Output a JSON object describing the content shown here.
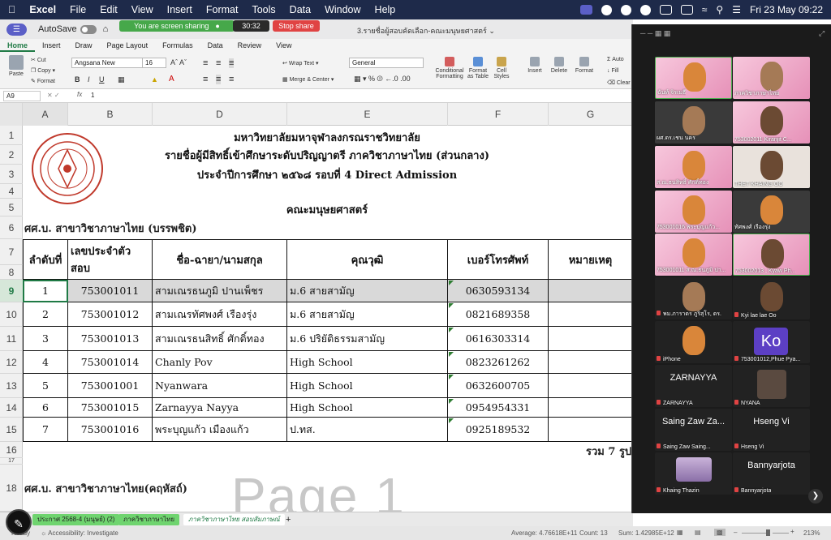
{
  "menubar": {
    "app": "Excel",
    "items": [
      "File",
      "Edit",
      "View",
      "Insert",
      "Format",
      "Tools",
      "Data",
      "Window",
      "Help"
    ],
    "datetime": "Fri 23 May  09:22"
  },
  "titlebar": {
    "autosave_label": "AutoSave",
    "sharing": "You are screen sharing",
    "timer": "30:32",
    "stop_share": "Stop share",
    "doc_title": "3.รายชื่อผู้สอบคัดเลือก-คณะมนุษยศาสตร์"
  },
  "ribbon": {
    "tabs": [
      "Home",
      "Insert",
      "Draw",
      "Page Layout",
      "Formulas",
      "Data",
      "Review",
      "View"
    ],
    "paste": "Paste",
    "cut": "Cut",
    "copy": "Copy",
    "format": "Format",
    "font_name": "Angsana New",
    "font_size": "16",
    "wrap_text": "Wrap Text",
    "merge_center": "Merge & Center",
    "number_format": "General",
    "conditional": "Conditional Formatting",
    "format_table": "Format as Table",
    "cell_styles": "Cell Styles",
    "insert": "Insert",
    "delete": "Delete",
    "format_btn": "Format",
    "autosum": "Auto",
    "fill": "Fill",
    "clear": "Clear"
  },
  "formula_bar": {
    "cell_ref": "A9",
    "fx": "fx",
    "value": "1"
  },
  "columns": [
    "A",
    "B",
    "D",
    "E",
    "F",
    "G"
  ],
  "rows": [
    "1",
    "2",
    "3",
    "4",
    "5",
    "6",
    "7",
    "8",
    "9",
    "10",
    "11",
    "12",
    "13",
    "14",
    "15",
    "16",
    "17",
    "18"
  ],
  "titles": {
    "line1": "มหาวิทยาลัยมหาจุฬาลงกรณราชวิทยาลัย",
    "line2": "รายชื่อผู้มีสิทธิ์เข้าศึกษาระดับปริญญาตรี ภาควิชาภาษาไทย (ส่วนกลาง)",
    "line3": "ประจำปีการศึกษา ๒๕๖๘ รอบที่ 4 Direct Admission",
    "faculty": "คณะมนุษยศาสตร์",
    "section1": "ศศ.บ. สาขาวิชาภาษาไทย (บรรพชิต)",
    "section2": "ศศ.บ. สาขาวิชาภาษาไทย(คฤหัสถ์)"
  },
  "table": {
    "headers": [
      "ลำดับที่",
      "เลขประจำตัวสอบ",
      "ชื่อ-ฉายา/นามสกุล",
      "คุณวุฒิ",
      "เบอร์โทรศัพท์",
      "หมายเหตุ"
    ],
    "rows": [
      [
        "1",
        "753001011",
        "สามเณรธนภูมิ ปานเพ็ชร",
        "ม.6 สายสามัญ",
        "0630593134",
        ""
      ],
      [
        "2",
        "753001012",
        "สามเณรทัศพงศ์ เรืองรุ่ง",
        "ม.6 สายสามัญ",
        "0821689358",
        ""
      ],
      [
        "3",
        "753001013",
        "สามเณรธนสิทธิ์ ศักดิ์ทอง",
        "ม.6 ปริยัติธรรมสามัญ",
        "0616303314",
        ""
      ],
      [
        "4",
        "753001014",
        "Chanly Pov",
        "High School",
        "0823261262",
        ""
      ],
      [
        "5",
        "753001001",
        "Nyanwara",
        "High School",
        "0632600705",
        ""
      ],
      [
        "6",
        "753001015",
        "Zarnayya Nayya",
        "High School",
        "0954954331",
        ""
      ],
      [
        "7",
        "753001016",
        "พระบุญแก้ว เมืองแก้ว",
        "ป.ทส.",
        "0925189532",
        ""
      ]
    ],
    "total": "รวม 7 รูป"
  },
  "watermark": "Page 1",
  "sheet_tabs": [
    "ประกาศ 2568-4 (มนุษย์) (2)",
    "ภาควิชาภาษาไทย",
    "ภาควิชาภาษาไทย สอบสัมภาษณ์"
  ],
  "status": {
    "ready": "Ready",
    "accessibility": "Accessibility: Investigate",
    "average": "Average: 4.76618E+11",
    "count": "Count: 13",
    "sum": "Sum: 1.42985E+12",
    "zoom": "213%"
  },
  "participants": [
    {
      "name": "ฉันท์ จิรเมธี",
      "style": "pink"
    },
    {
      "name": "ภาควิชาภาษาไทย",
      "style": "pink"
    },
    {
      "name": "ผศ.ดร.เชน นคร",
      "style": "dark"
    },
    {
      "name": "753002011 Kiranjit C...",
      "style": "pink"
    },
    {
      "name": "ส.ณ.ธนสิทธิ์ ศักดิ์ทอง",
      "style": "pink"
    },
    {
      "name": "THET KHAING OO",
      "style": "dark"
    },
    {
      "name": "753001016 พระบุญแก้ว...",
      "style": "pink"
    },
    {
      "name": "ทัศพงศ์ เรืองรุ่ง",
      "style": "dark"
    },
    {
      "name": "753001011 ส.ณ.ธนภูมิ ปา...",
      "style": "pink"
    },
    {
      "name": "753002013 , Kyaw Ph...",
      "style": "pink"
    },
    {
      "name": "พม.ภาราดร ภูริสุโร, ดร.",
      "style": "dark"
    },
    {
      "name": "Kyi lae lae Oo",
      "style": "dark"
    },
    {
      "name": "iPhone",
      "style": "dark"
    },
    {
      "name": "753001012,Phue Pya...",
      "style": "dark",
      "avatar": "Ko"
    },
    {
      "name": "ZARNAYYA",
      "style": "dark",
      "big": "ZARNAYYA"
    },
    {
      "name": "NYANA",
      "style": "dark"
    },
    {
      "name": "Saing Zaw Saing...",
      "style": "dark",
      "big": "Saing Zaw Za..."
    },
    {
      "name": "Hseng Vi",
      "style": "dark",
      "big": "Hseng Vi"
    },
    {
      "name": "Khaing Thazin",
      "style": "dark"
    },
    {
      "name": "Bannyarjota",
      "style": "dark",
      "big": "Bannyarjota"
    }
  ]
}
